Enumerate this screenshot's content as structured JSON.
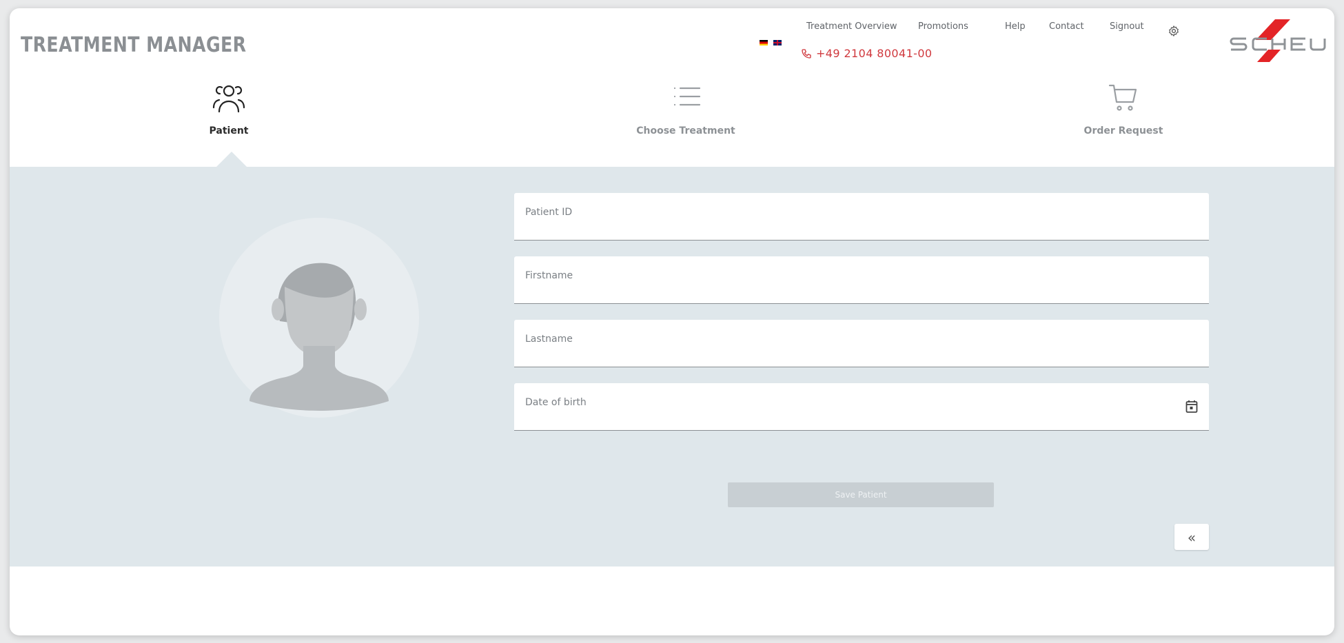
{
  "header": {
    "app_title": "TREATMENT MANAGER",
    "phone": "+49 2104 80041-00",
    "nav": {
      "treatment_overview": "Treatment Overview",
      "promotions": "Promotions",
      "help": "Help",
      "contact": "Contact",
      "signout": "Signout"
    },
    "languages": [
      "de",
      "en"
    ],
    "logo_text": "SCHEU",
    "brand_color": "#e32427"
  },
  "steps": [
    {
      "label": "Patient",
      "icon": "users-icon",
      "active": true
    },
    {
      "label": "Choose Treatment",
      "icon": "list-icon",
      "active": false
    },
    {
      "label": "Order Request",
      "icon": "cart-icon",
      "active": false
    }
  ],
  "form": {
    "patient_id": {
      "label": "Patient ID",
      "value": ""
    },
    "firstname": {
      "label": "Firstname",
      "value": ""
    },
    "lastname": {
      "label": "Lastname",
      "value": ""
    },
    "date_of_birth": {
      "label": "Date of birth",
      "value": ""
    },
    "save_label": "Save Patient",
    "collapse_label": "«"
  },
  "colors": {
    "panel_bg": "#dfe7eb",
    "phone": "#d0393e",
    "button_disabled": "#c8cfd3"
  }
}
